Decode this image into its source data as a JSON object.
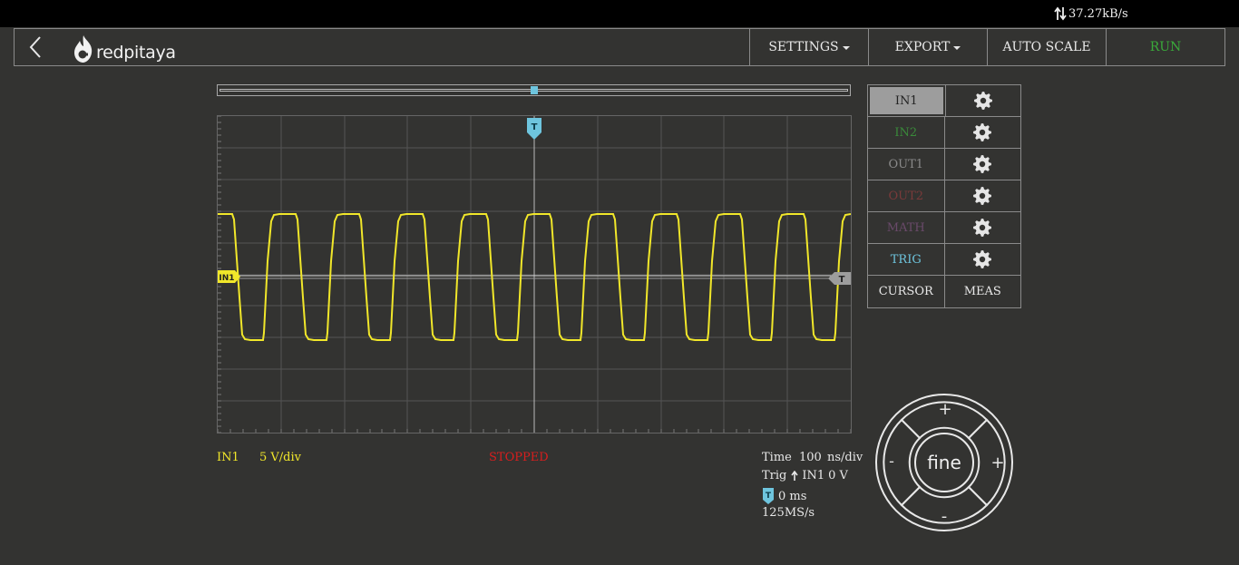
{
  "status": {
    "rate": "37.27kB/s"
  },
  "navbar": {
    "logo_text": "redpitaya",
    "settings": "SETTINGS",
    "export": "EXPORT",
    "autoscale": "AUTO SCALE",
    "run": "RUN"
  },
  "colors": {
    "in1": "#f1e72a",
    "in2": "#3a8a3a",
    "out1": "#8a8a8a",
    "out2": "#7a3a3a",
    "math": "#6a4a6a",
    "trig": "#6ec5de",
    "run": "#3aaa3a",
    "stopped": "#d81e1e"
  },
  "channels": [
    {
      "label": "IN1",
      "icon": "gear-icon"
    },
    {
      "label": "IN2",
      "icon": "gear-icon"
    },
    {
      "label": "OUT1",
      "icon": "gear-icon"
    },
    {
      "label": "OUT2",
      "icon": "gear-icon"
    },
    {
      "label": "MATH",
      "icon": "gear-icon"
    },
    {
      "label": "TRIG",
      "icon": "gear-icon"
    }
  ],
  "tools": {
    "cursor": "CURSOR",
    "meas": "MEAS"
  },
  "plot": {
    "trigger_marker": "T",
    "in1_marker": "IN1",
    "level_marker": "T",
    "timeline_position": 0.5
  },
  "readout": {
    "channel": "IN1",
    "scale": "5 V/div",
    "state": "STOPPED",
    "time_label": "Time",
    "time_value": "100",
    "time_unit": "ns/div",
    "trig_label": "Trig",
    "trig_source": "IN1",
    "trig_level": "0 V",
    "trig_marker": "T",
    "trig_delay": "0 ms",
    "sample_rate": "125MS/s"
  },
  "dial": {
    "center": "fine",
    "top": "+",
    "bottom": "-",
    "left": "-",
    "right": "+"
  }
}
